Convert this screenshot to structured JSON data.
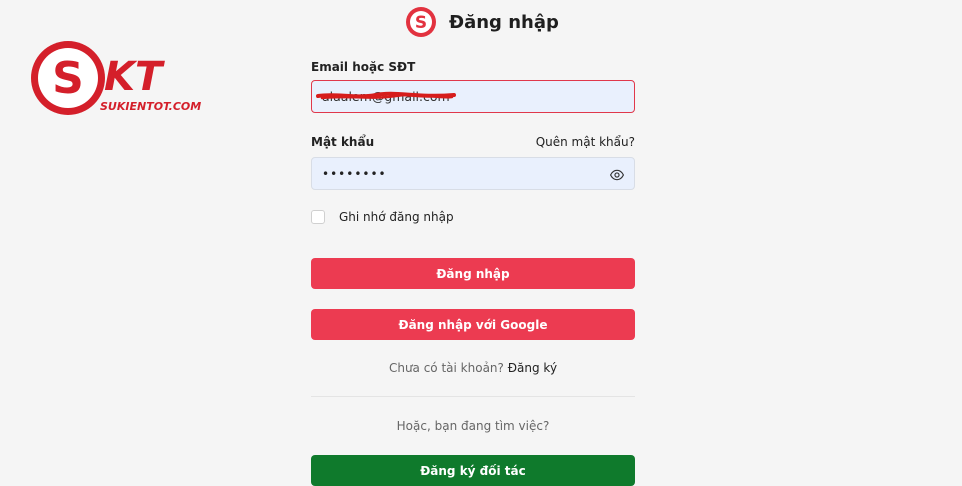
{
  "watermark": {
    "letters": "SKT",
    "site": "SUKIENTOT.COM"
  },
  "header": {
    "title": "Đăng nhập",
    "icon": "brand-s-logo-icon",
    "brand_color": "#e2323f"
  },
  "form": {
    "email_label": "Email hoặc SĐT",
    "email_value": "alaalem@gmail.com",
    "password_label": "Mật khẩu",
    "forgot_link": "Quên mật khẩu?",
    "password_value": "••••••••",
    "remember_label": "Ghi nhớ đăng nhập",
    "login_button": "Đăng nhập",
    "google_button": "Đăng nhập với Google",
    "no_account_text": "Chưa có tài khoản?",
    "signup_link": "Đăng ký",
    "jobseeker_text": "Hoặc, bạn đang tìm việc?",
    "partner_button": "Đăng ký đối tác"
  },
  "colors": {
    "primary": "#ec3b51",
    "partner": "#0f7a2c",
    "input_bg": "#e9f0fd"
  }
}
